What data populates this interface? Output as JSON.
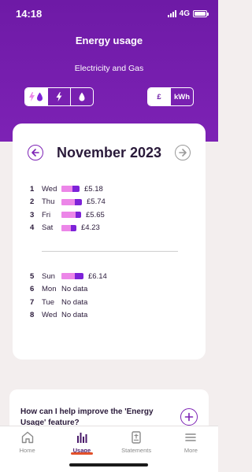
{
  "status_bar": {
    "time": "14:18",
    "network": "4G"
  },
  "header": {
    "title": "Energy usage",
    "subtitle": "Electricity and Gas",
    "fuel_options": [
      "electricity-and-gas",
      "electricity",
      "gas"
    ],
    "fuel_selected": "electricity-and-gas",
    "unit_options": [
      "£",
      "kWh"
    ],
    "unit_selected": "£"
  },
  "calendar": {
    "month": "November 2023",
    "weeks": [
      [
        {
          "num": "1",
          "day": "Wed",
          "value": "£5.18",
          "elec": 14,
          "gas": 9
        },
        {
          "num": "2",
          "day": "Thu",
          "value": "£5.74",
          "elec": 17,
          "gas": 9
        },
        {
          "num": "3",
          "day": "Fri",
          "value": "£5.65",
          "elec": 18,
          "gas": 7
        },
        {
          "num": "4",
          "day": "Sat",
          "value": "£4.23",
          "elec": 12,
          "gas": 7
        }
      ],
      [
        {
          "num": "5",
          "day": "Sun",
          "value": "£6.14",
          "elec": 17,
          "gas": 11
        },
        {
          "num": "6",
          "day": "Mon",
          "value": "No data",
          "elec": 0,
          "gas": 0
        },
        {
          "num": "7",
          "day": "Tue",
          "value": "No data",
          "elec": 0,
          "gas": 0
        },
        {
          "num": "8",
          "day": "Wed",
          "value": "No data",
          "elec": 0,
          "gas": 0
        }
      ]
    ]
  },
  "help": {
    "text": "How can I help improve the 'Energy Usage' feature?"
  },
  "tabs": [
    {
      "label": "Home",
      "icon": "home-icon",
      "active": false
    },
    {
      "label": "Usage",
      "icon": "usage-icon",
      "active": true
    },
    {
      "label": "Statements",
      "icon": "statements-icon",
      "active": false
    },
    {
      "label": "More",
      "icon": "more-icon",
      "active": false
    }
  ],
  "colors": {
    "brand": "#6e1aa6",
    "electricity": "#ec86e8",
    "gas": "#7d22d8",
    "active_tab": "#e2502a"
  }
}
